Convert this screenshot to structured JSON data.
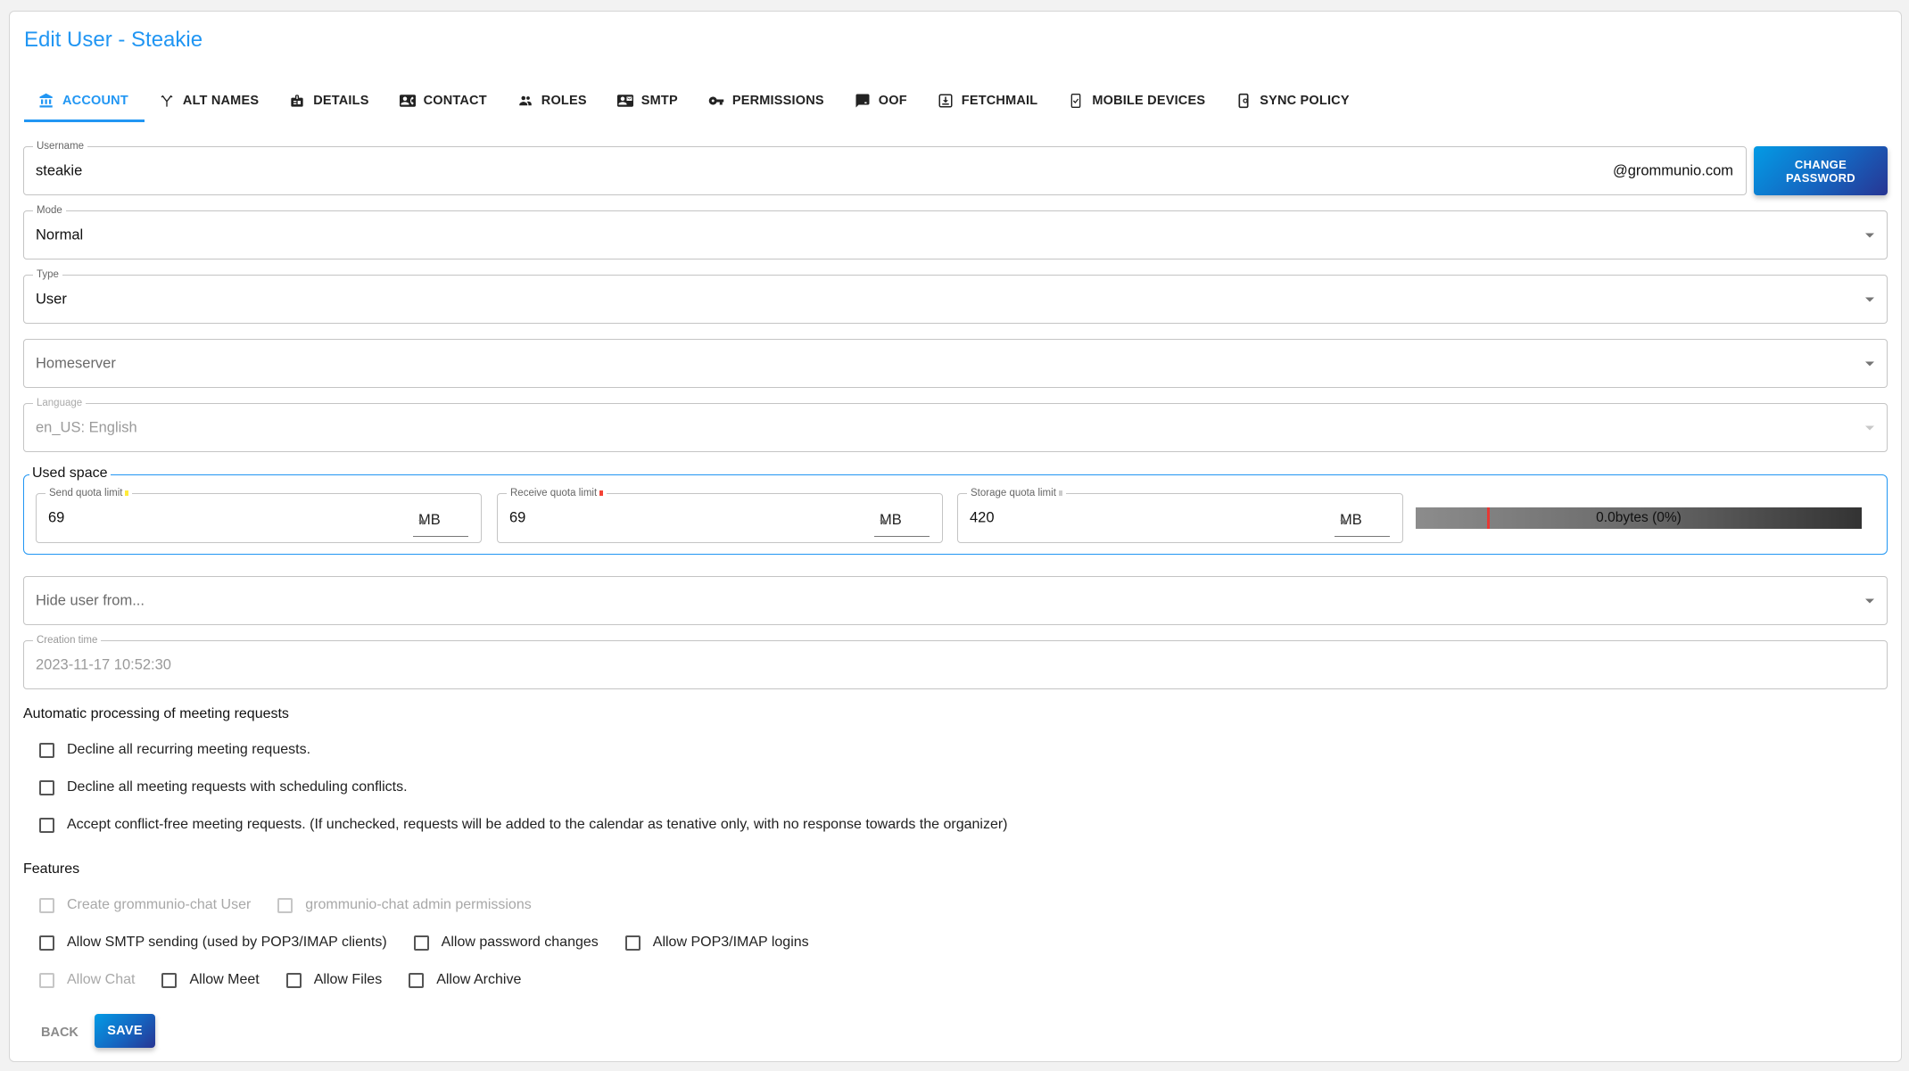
{
  "page": {
    "title": "Edit User - Steakie"
  },
  "tabs": [
    {
      "label": "ACCOUNT",
      "icon": "bank-icon",
      "active": true
    },
    {
      "label": "ALT NAMES",
      "icon": "fork-icon",
      "active": false
    },
    {
      "label": "DETAILS",
      "icon": "badge-icon",
      "active": false
    },
    {
      "label": "CONTACT",
      "icon": "contact-card-icon",
      "active": false
    },
    {
      "label": "ROLES",
      "icon": "people-icon",
      "active": false
    },
    {
      "label": "SMTP",
      "icon": "contact-mail-icon",
      "active": false
    },
    {
      "label": "PERMISSIONS",
      "icon": "key-icon",
      "active": false
    },
    {
      "label": "OOF",
      "icon": "speaker-notes-off-icon",
      "active": false
    },
    {
      "label": "FETCHMAIL",
      "icon": "download-box-icon",
      "active": false
    },
    {
      "label": "MOBILE DEVICES",
      "icon": "phone-check-icon",
      "active": false
    },
    {
      "label": "SYNC POLICY",
      "icon": "phone-settings-icon",
      "active": false
    }
  ],
  "form": {
    "username": {
      "label": "Username",
      "value": "steakie",
      "suffix": "@grommunio.com"
    },
    "change_password_label": "CHANGE PASSWORD",
    "mode": {
      "label": "Mode",
      "value": "Normal"
    },
    "type": {
      "label": "Type",
      "value": "User"
    },
    "homeserver": {
      "placeholder": "Homeserver"
    },
    "language": {
      "label": "Language",
      "value": "en_US: English"
    },
    "used_space": {
      "legend": "Used space",
      "send_quota": {
        "label": "Send quota limit",
        "value": "69",
        "unit": "MB",
        "dot_color": "#ffeb3b"
      },
      "receive_quota": {
        "label": "Receive quota limit",
        "value": "69",
        "unit": "MB",
        "dot_color": "#f44336"
      },
      "storage_quota": {
        "label": "Storage quota limit",
        "value": "420",
        "unit": "MB",
        "dot_color": "#cccccc"
      },
      "usage_text": "0.0bytes (0%)",
      "usage_percent": 0
    },
    "hide_user": {
      "placeholder": "Hide user from..."
    },
    "creation_time": {
      "label": "Creation time",
      "value": "2023-11-17 10:52:30"
    }
  },
  "meeting": {
    "heading": "Automatic processing of meeting requests",
    "options": [
      {
        "label": "Decline all recurring meeting requests.",
        "checked": false
      },
      {
        "label": "Decline all meeting requests with scheduling conflicts.",
        "checked": false
      },
      {
        "label": "Accept conflict-free meeting requests. (If unchecked, requests will be added to the calendar as tenative only, with no response towards the organizer)",
        "checked": false
      }
    ]
  },
  "features": {
    "heading": "Features",
    "row1": [
      {
        "label": "Create grommunio-chat User",
        "checked": false,
        "disabled": true
      },
      {
        "label": "grommunio-chat admin permissions",
        "checked": false,
        "disabled": true
      }
    ],
    "row2": [
      {
        "label": "Allow SMTP sending (used by POP3/IMAP clients)",
        "checked": false,
        "disabled": false
      },
      {
        "label": "Allow password changes",
        "checked": false,
        "disabled": false
      },
      {
        "label": "Allow POP3/IMAP logins",
        "checked": false,
        "disabled": false
      }
    ],
    "row3": [
      {
        "label": "Allow Chat",
        "checked": false,
        "disabled": true
      },
      {
        "label": "Allow Meet",
        "checked": false,
        "disabled": false
      },
      {
        "label": "Allow Files",
        "checked": false,
        "disabled": false
      },
      {
        "label": "Allow Archive",
        "checked": false,
        "disabled": false
      }
    ]
  },
  "actions": {
    "back_label": "BACK",
    "save_label": "SAVE"
  },
  "colors": {
    "accent": "#2196f3",
    "button_gradient_start": "#039be5",
    "button_gradient_end": "#283593",
    "quota_marker": "#e53935"
  }
}
